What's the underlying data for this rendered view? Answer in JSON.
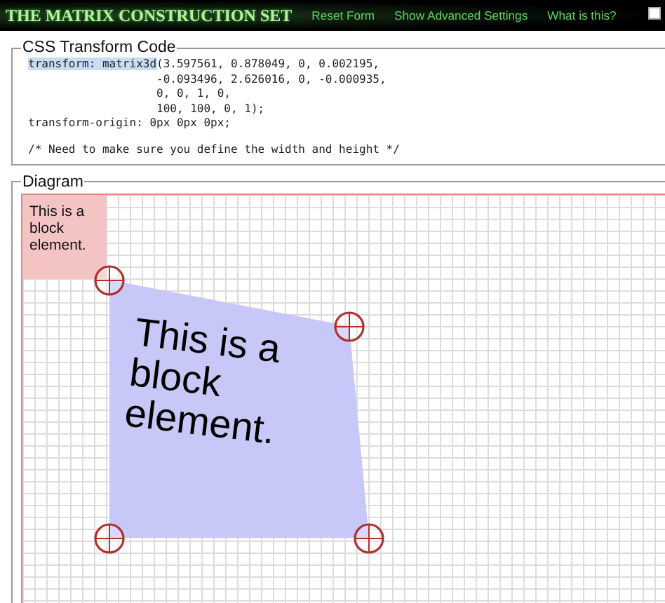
{
  "header": {
    "title": "THE MATRIX CONSTRUCTION SET",
    "links": [
      "Reset Form",
      "Show Advanced Settings",
      "What is this?"
    ],
    "checkbox": {
      "checked": false
    }
  },
  "code_panel": {
    "legend": "CSS Transform Code",
    "selection": "transform: matrix3d",
    "lines": [
      "(3.597561, 0.878049, 0, 0.002195,",
      "                   -0.093496, 2.626016, 0, -0.000935,",
      "                   0, 0, 1, 0,",
      "                   100, 100, 0, 1);",
      "transform-origin: 0px 0px 0px;"
    ],
    "comment": "/* Need to make sure you define the width and height */"
  },
  "diagram": {
    "legend": "Diagram",
    "original_block": "This is a block element.",
    "transformed_block": "This is a block element."
  }
}
